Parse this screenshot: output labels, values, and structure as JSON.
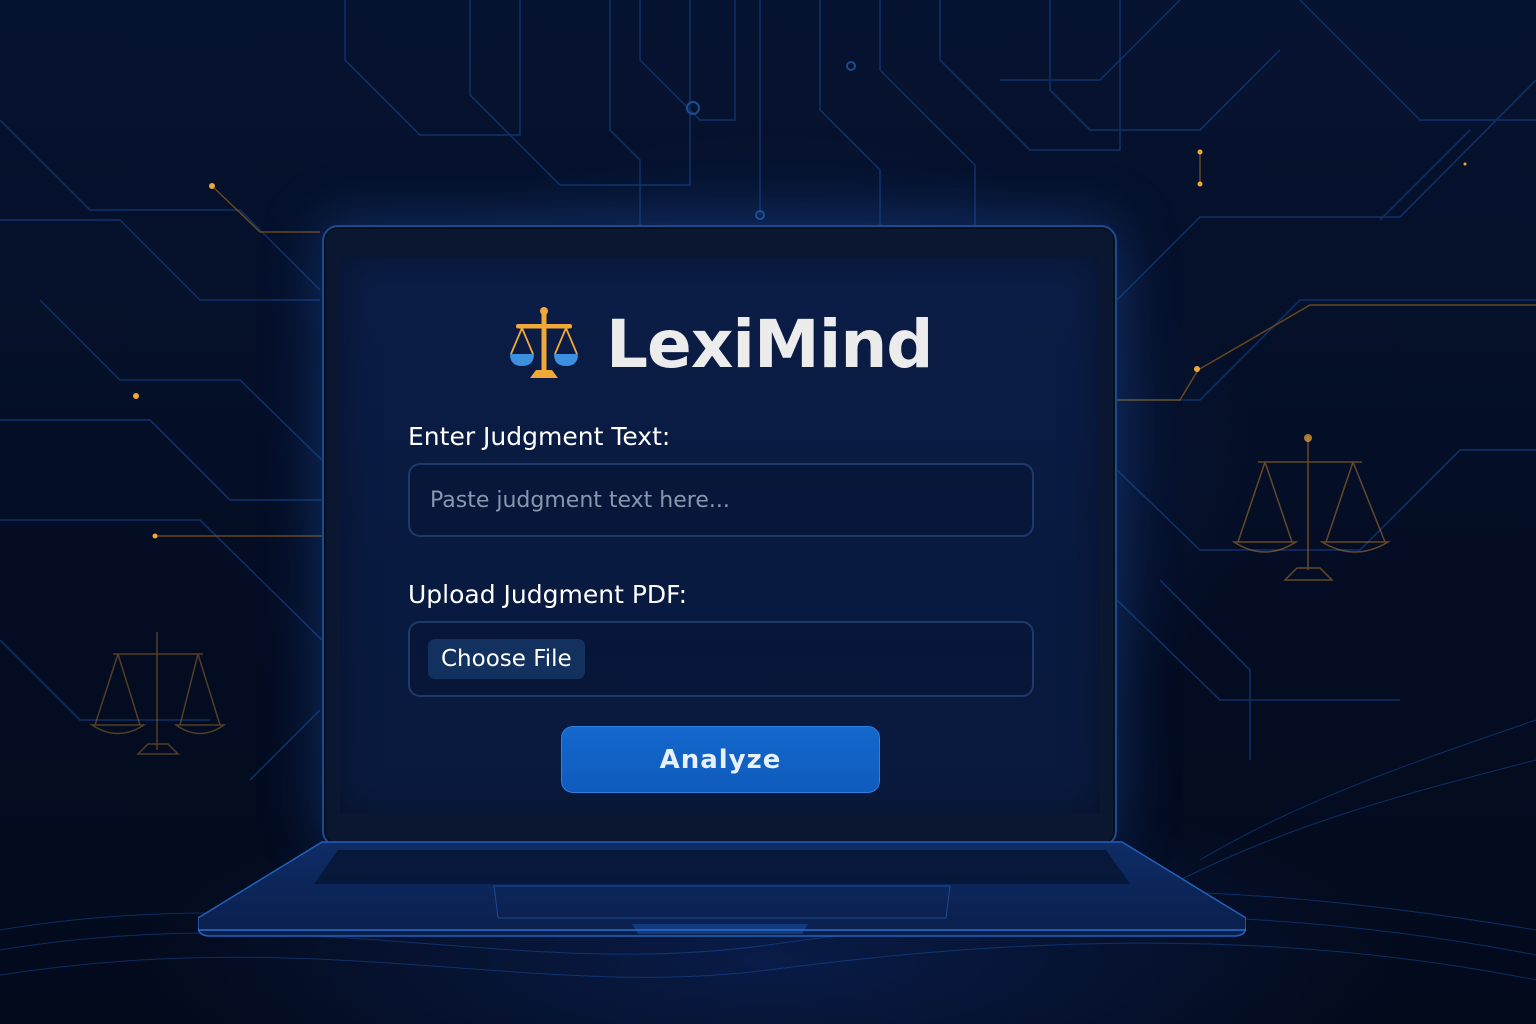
{
  "app": {
    "name": "LexiMind",
    "logo_icon": "scales-of-justice-icon"
  },
  "form": {
    "text_label": "Enter Judgment Text:",
    "text_placeholder": "Paste judgment text here...",
    "text_value": "",
    "pdf_label": "Upload Judgment PDF:",
    "file_button_label": "Choose File",
    "submit_label": "Analyze"
  },
  "colors": {
    "background": "#040d22",
    "screen": "#0b1d46",
    "accent_blue": "#1468cc",
    "accent_gold": "#f0a83a",
    "scale_pans": "#3d8fe0",
    "brand_text": "#ececec"
  }
}
